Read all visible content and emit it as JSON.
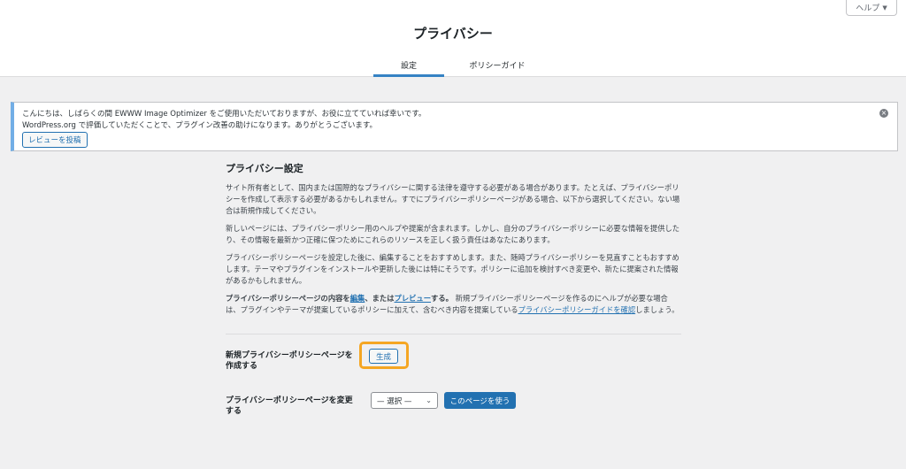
{
  "header": {
    "help_label": "ヘルプ",
    "title": "プライバシー",
    "tabs": [
      {
        "label": "設定",
        "active": true
      },
      {
        "label": "ポリシーガイド",
        "active": false
      }
    ]
  },
  "notice": {
    "line1": "こんにちは、しばらくの間 EWWW Image Optimizer をご使用いただいておりますが、お役に立てていれば幸いです。",
    "line2": "WordPress.org で評価していただくことで、プラグイン改善の助けになります。ありがとうございます。",
    "button": "レビューを投稿",
    "accent_color": "#72aee6"
  },
  "settings": {
    "title": "プライバシー設定",
    "para1": "サイト所有者として、国内または国際的なプライバシーに関する法律を遵守する必要がある場合があります。たとえば、プライバシーポリシーを作成して表示する必要があるかもしれません。すでにプライバシーポリシーページがある場合、以下から選択してください。ない場合は新規作成してください。",
    "para2": "新しいページには、プライバシーポリシー用のヘルプや提案が含まれます。しかし、自分のプライバシーポリシーに必要な情報を提供したり、その情報を最新かつ正確に保つためにこれらのリソースを正しく扱う責任はあなたにあります。",
    "para3": "プライバシーポリシーページを設定した後に、編集することをおすすめします。また、随時プライバシーポリシーを見直すこともおすすめします。テーマやプラグインをインストールや更新した後には特にそうです。ポリシーに追加を検討すべき変更や、新たに提案された情報があるかもしれません。",
    "para4_bold_prefix": "プライバシーポリシーページの内容を",
    "para4_edit_link": "編集",
    "para4_bold_mid": "、または",
    "para4_preview_link": "プレビュー",
    "para4_bold_suffix": "する。",
    "para4_text": "新規プライバシーポリシーページを作るのにヘルプが必要な場合は、プラグインやテーマが提案しているポリシーに加えて、含むべき内容を提案している",
    "para4_guide_link": "プライバシーポリシーガイドを確認",
    "para4_end": "しましょう。",
    "create_label": "新規プライバシーポリシーページを作成する",
    "create_button": "生成",
    "change_label": "プライバシーポリシーページを変更する",
    "select_value": "— 選択 —",
    "use_button": "このページを使う",
    "highlight_color": "#f5a623",
    "primary_color": "#2271b1"
  }
}
